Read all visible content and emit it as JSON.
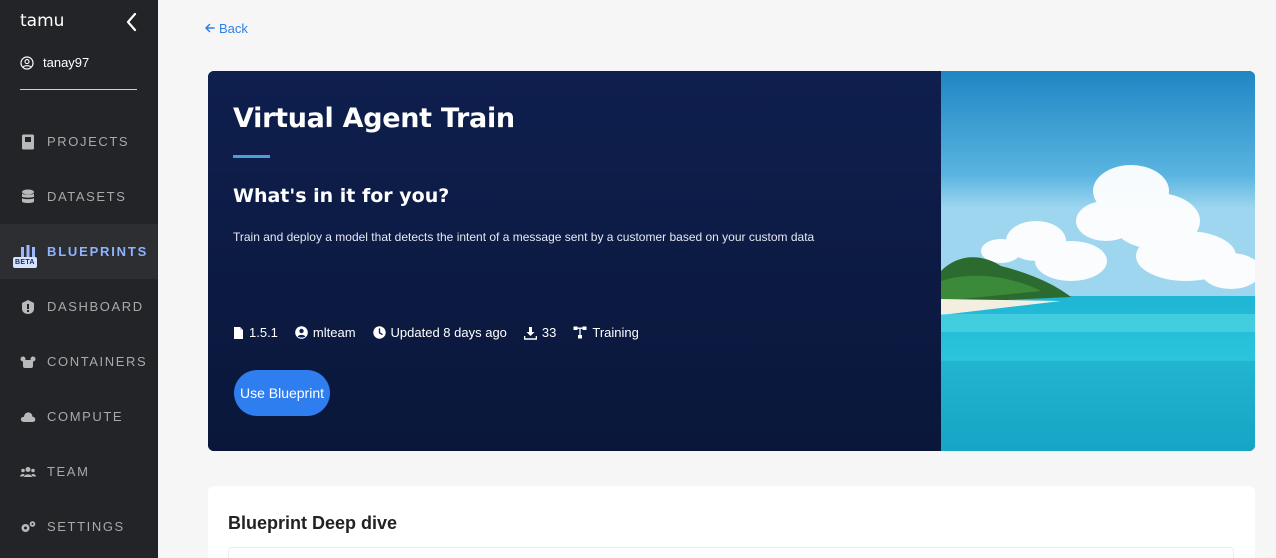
{
  "sidebar": {
    "org_name": "tamu",
    "username": "tanay97",
    "items": [
      {
        "label": "PROJECTS",
        "icon": "projects-icon"
      },
      {
        "label": "DATASETS",
        "icon": "database-icon"
      },
      {
        "label": "BLUEPRINTS",
        "icon": "blueprints-icon",
        "badge": "BETA",
        "active": true
      },
      {
        "label": "DASHBOARD",
        "icon": "dashboard-icon"
      },
      {
        "label": "CONTAINERS",
        "icon": "containers-icon"
      },
      {
        "label": "COMPUTE",
        "icon": "cloud-icon"
      },
      {
        "label": "TEAM",
        "icon": "team-icon"
      },
      {
        "label": "SETTINGS",
        "icon": "settings-icon"
      }
    ]
  },
  "main": {
    "back_label": "Back",
    "hero": {
      "title": "Virtual Agent Train",
      "subtitle": "What's in it for you?",
      "description": "Train and deploy a model that detects the intent of a message sent by a customer based on your custom data",
      "meta": {
        "version": "1.5.1",
        "author": "mlteam",
        "updated": "Updated 8 days ago",
        "downloads": "33",
        "category": "Training"
      },
      "cta_label": "Use Blueprint"
    },
    "deep_dive_title": "Blueprint Deep dive"
  },
  "colors": {
    "sidebar_bg": "#222427",
    "hero_bg": "#0f1f4e",
    "accent": "#2e7ef0",
    "active_nav": "#8fb3ff"
  }
}
